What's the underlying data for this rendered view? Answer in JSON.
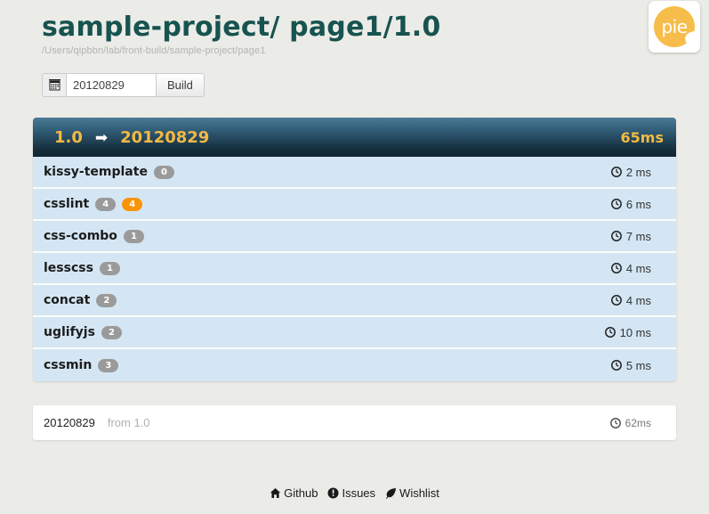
{
  "logo": {
    "text": "pie",
    "circle_color": "#f7bd4a"
  },
  "header": {
    "title": "sample-project/ page1/1.0",
    "subtitle": "/Users/qipbbn/lab/front-build/sample-project/page1"
  },
  "build_form": {
    "calendar_icon": "calendar-icon",
    "date_value": "20120829",
    "date_placeholder": "20120829",
    "build_label": "Build"
  },
  "card": {
    "head": {
      "version": "1.0",
      "arrow": "➡",
      "date": "20120829",
      "total_time": "65ms",
      "accent_color": "#f4b942"
    },
    "tasks": [
      {
        "name": "kissy-template",
        "badges": [
          {
            "value": "0",
            "type": "default"
          }
        ],
        "time": "2 ms"
      },
      {
        "name": "csslint",
        "badges": [
          {
            "value": "4",
            "type": "default"
          },
          {
            "value": "4",
            "type": "warn"
          }
        ],
        "time": "6 ms"
      },
      {
        "name": "css-combo",
        "badges": [
          {
            "value": "1",
            "type": "default"
          }
        ],
        "time": "7 ms"
      },
      {
        "name": "lesscss",
        "badges": [
          {
            "value": "1",
            "type": "default"
          }
        ],
        "time": "4 ms"
      },
      {
        "name": "concat",
        "badges": [
          {
            "value": "2",
            "type": "default"
          }
        ],
        "time": "4 ms"
      },
      {
        "name": "uglifyjs",
        "badges": [
          {
            "value": "2",
            "type": "default"
          }
        ],
        "time": "10 ms"
      },
      {
        "name": "cssmin",
        "badges": [
          {
            "value": "3",
            "type": "default"
          }
        ],
        "time": "5 ms"
      }
    ]
  },
  "summary": {
    "date": "20120829",
    "from": "from 1.0",
    "time": "62ms"
  },
  "footer_links": [
    {
      "icon": "home-icon",
      "label": "Github"
    },
    {
      "icon": "info-circle-icon",
      "label": "Issues"
    },
    {
      "icon": "leaf-icon",
      "label": "Wishlist"
    }
  ]
}
